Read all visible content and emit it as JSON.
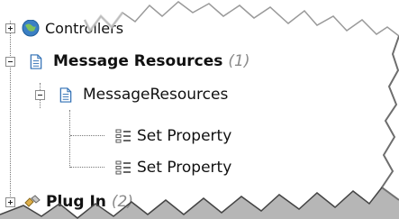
{
  "tree": {
    "top_item": {
      "label": "Controllers"
    },
    "message_resources": {
      "label": "Message Resources",
      "count": "(1)"
    },
    "child": {
      "label": "MessageResources"
    },
    "properties": [
      {
        "label": "Set Property"
      },
      {
        "label": "Set Property"
      }
    ],
    "bottom_item": {
      "label": "Plug In",
      "count": "(2)"
    }
  },
  "colors": {
    "doc_blue": "#2f6fb4",
    "globe": "#3b7fc4"
  }
}
